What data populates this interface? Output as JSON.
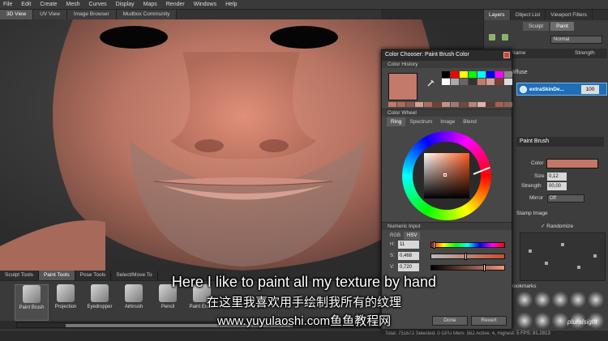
{
  "menubar": [
    "File",
    "Edit",
    "Create",
    "Mesh",
    "Curves",
    "Display",
    "Maps",
    "Render",
    "Windows",
    "Help"
  ],
  "view_tabs": [
    "3D View",
    "UV View",
    "Image Browser",
    "Mudbox Community"
  ],
  "right_panel": {
    "tabs": [
      "Layers",
      "Object List",
      "Viewport Filters"
    ],
    "sub_tabs": [
      "Sculpt",
      "Paint"
    ],
    "blend_mode": "Normal",
    "col_name": "Name",
    "col_strength": "Strength",
    "channel": "Diffuse",
    "layer_name": "extraSkinDe...",
    "layer_value": "100",
    "brush_title": "Paint Brush",
    "color_label": "Color",
    "color_value": "#c27865",
    "size_label": "Size",
    "size_value": "0,12",
    "strength_label": "Strength",
    "strength_value": "00,00",
    "mirror_label": "Mirror",
    "mirror_value": "Off",
    "stamp_label": "Stamp Image",
    "randomize_label": "Randomize",
    "bookmarks_label": "Bookmarks"
  },
  "dialog": {
    "title": "Color Chooser: Paint Brush Color",
    "history_label": "Color History",
    "current_color": "#c47a6a",
    "wheel_label": "Color Wheel",
    "wheel_tabs": [
      "Ring",
      "Spectrum",
      "Image",
      "Blend"
    ],
    "numeric_label": "Numeric Input",
    "mode_tabs": [
      "RGB",
      "HSV"
    ],
    "hsv": [
      {
        "label": "H:",
        "value": "11",
        "fraction": 0.03
      },
      {
        "label": "S:",
        "value": "0,468",
        "fraction": 0.468
      },
      {
        "label": "V:",
        "value": "0,720",
        "fraction": 0.72
      }
    ],
    "done": "Done",
    "revert": "Revert"
  },
  "shelf": {
    "tabs": [
      "Sculpt Tools",
      "Paint Tools",
      "Pose Tools",
      "Select/Move To"
    ],
    "tools": [
      "Paint Brush",
      "Projection",
      "Eyedropper",
      "Airbrush",
      "Pencil",
      "Paint Erase"
    ]
  },
  "status": "Total: 751672  Selected: 0  GPU Mem: 562  Active: 4, Highest: 5  FPS: 81.2813",
  "subtitles": {
    "line1": "Here I like to paint all my texture by hand",
    "line2": "在这里我喜欢用手绘制我所有的纹理",
    "line3": "www.yuyulaoshi.com鱼鱼教程网"
  },
  "watermark": "pluralsight"
}
